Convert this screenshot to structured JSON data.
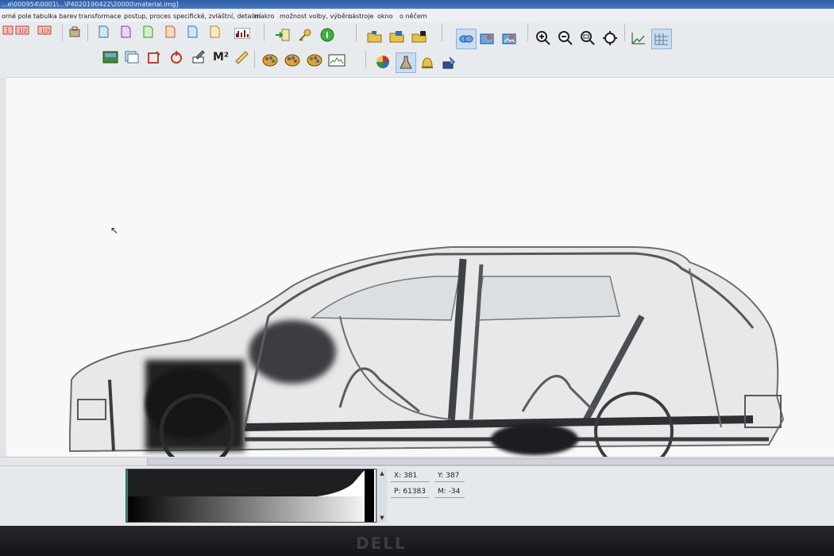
{
  "window": {
    "title": "...e\\000954\\0001\\...\\P4020190422\\20000\\material.img]"
  },
  "menu": [
    "orné pole",
    "tabulka barev",
    "transformace",
    "postup, proces",
    "specifické, zvláštní, detailní",
    "makro",
    "možnost volby, výběru",
    "nástroje",
    "okno",
    "o něčem"
  ],
  "toolbar": {
    "m2_label": "M²",
    "icons_row1": [
      "layout-1-icon",
      "layout-2-icon",
      "layout-3-icon",
      "briefcase-icon",
      "page-1-icon",
      "page-2-icon",
      "page-3-icon",
      "page-4-icon",
      "page-5-icon",
      "page-6-icon",
      "histogram-icon",
      "import-icon",
      "key-icon",
      "info-icon",
      "open-folder-icon",
      "stack-icon",
      "lock-icon",
      "link-icon",
      "bitmap-1-icon",
      "bitmap-2-icon",
      "zoom-in-icon",
      "zoom-out-icon",
      "zoom-fit-icon",
      "zoom-custom-icon",
      "graph-icon",
      "grid-icon"
    ],
    "icons_row2": [
      "image-view-icon",
      "pages-icon",
      "frame-icon",
      "rotate-icon",
      "edit-icon",
      "measure-area-icon",
      "ruler-icon",
      "palette-1-icon",
      "palette-2-icon",
      "palette-3-icon",
      "monitor-icon",
      "color-wheel-icon",
      "flask-icon",
      "bell-icon",
      "fill-icon"
    ]
  },
  "status": {
    "x_label": "X:",
    "x_value": "381",
    "y_label": "Y:",
    "y_value": "387",
    "p_label": "P:",
    "p_value": "61383",
    "m_label": "M:",
    "m_value": "-34"
  },
  "monitor": {
    "brand": "DELL"
  }
}
